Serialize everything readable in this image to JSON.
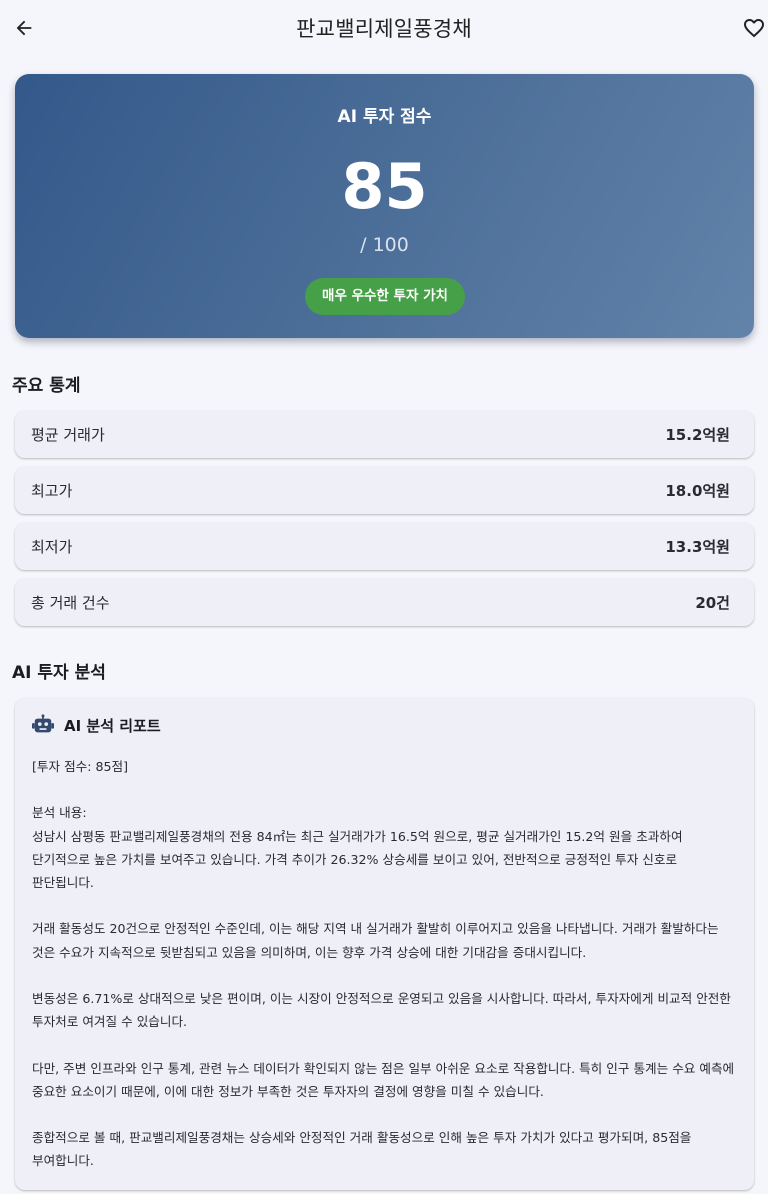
{
  "appbar": {
    "title": "판교밸리제일풍경채",
    "back_icon": "arrow-left-icon",
    "favorite_icon": "heart-outline-icon"
  },
  "score_card": {
    "label": "AI 투자 점수",
    "score": "85",
    "max": "/ 100",
    "badge": "매우 우수한 투자 가치",
    "colors": {
      "gradient_start": "#34588a",
      "gradient_end": "#6283aa",
      "badge": "#46a047"
    }
  },
  "stats": {
    "title": "주요 통계",
    "rows": [
      {
        "label": "평균 거래가",
        "value": "15.2억원"
      },
      {
        "label": "최고가",
        "value": "18.0억원"
      },
      {
        "label": "최저가",
        "value": "13.3억원"
      },
      {
        "label": "총 거래 건수",
        "value": "20건"
      }
    ]
  },
  "analysis": {
    "title": "AI 투자 분석",
    "report_title": "AI 분석 리포트",
    "report_icon": "robot-icon",
    "report_text": "[투자 점수: 85점]\n\n분석 내용:\n성남시 삼평동 판교밸리제일풍경채의 전용 84㎡는 최근 실거래가가 16.5억 원으로, 평균 실거래가인 15.2억 원을 초과하여 단기적으로 높은 가치를 보여주고 있습니다. 가격 추이가 26.32% 상승세를 보이고 있어, 전반적으로 긍정적인 투자 신호로 판단됩니다.\n\n거래 활동성도 20건으로 안정적인 수준인데, 이는 해당 지역 내 실거래가 활발히 이루어지고 있음을 나타냅니다. 거래가 활발하다는 것은 수요가 지속적으로 뒷받침되고 있음을 의미하며, 이는 향후 가격 상승에 대한 기대감을 증대시킵니다.\n\n변동성은 6.71%로 상대적으로 낮은 편이며, 이는 시장이 안정적으로 운영되고 있음을 시사합니다. 따라서, 투자자에게 비교적 안전한 투자처로 여겨질 수 있습니다.\n\n다만, 주변 인프라와 인구 통계, 관련 뉴스 데이터가 확인되지 않는 점은 일부 아쉬운 요소로 작용합니다. 특히 인구 통계는 수요 예측에 중요한 요소이기 때문에, 이에 대한 정보가 부족한 것은 투자자의 결정에 영향을 미칠 수 있습니다.\n\n종합적으로 볼 때, 판교밸리제일풍경채는 상승세와 안정적인 거래 활동성으로 인해 높은 투자 가치가 있다고 평가되며, 85점을 부여합니다."
  }
}
